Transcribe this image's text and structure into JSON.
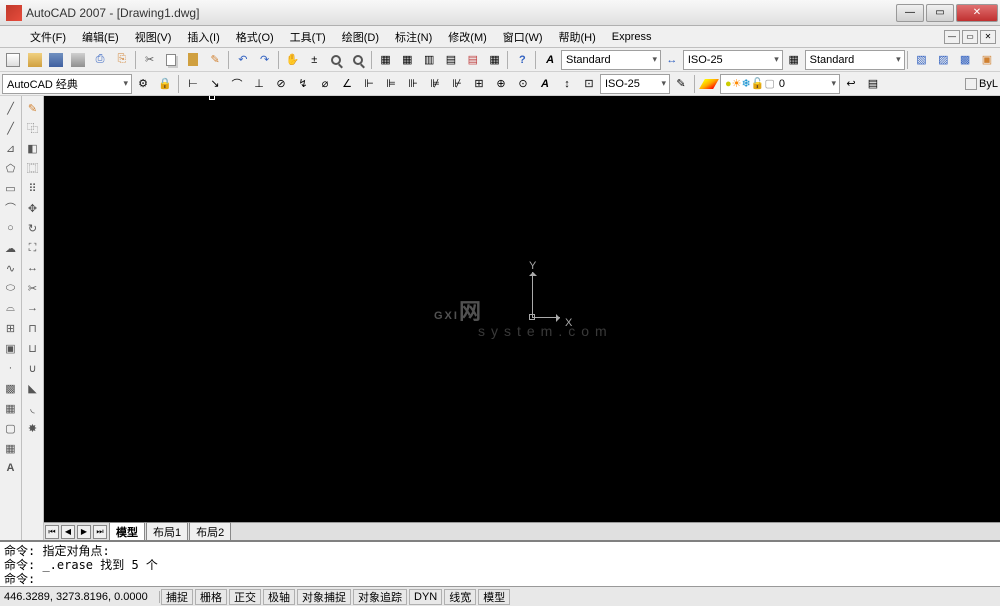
{
  "title": "AutoCAD 2007 - [Drawing1.dwg]",
  "menu": [
    "文件(F)",
    "编辑(E)",
    "视图(V)",
    "插入(I)",
    "格式(O)",
    "工具(T)",
    "绘图(D)",
    "标注(N)",
    "修改(M)",
    "窗口(W)",
    "帮助(H)",
    "Express"
  ],
  "workspace": "AutoCAD 经典",
  "styles": {
    "text_style": "Standard",
    "dim_style_1": "ISO-25",
    "table_style": "Standard",
    "dim_style_2": "ISO-25"
  },
  "layer": {
    "current": "0"
  },
  "bylayer": "ByL",
  "ucs": {
    "x_label": "X",
    "y_label": "Y"
  },
  "watermark": {
    "main": "GXI",
    "suffix": "网",
    "sub": "system.com"
  },
  "layout_tabs": {
    "model": "模型",
    "layout1": "布局1",
    "layout2": "布局2"
  },
  "command_log": "命令: 指定对角点:\n命令: _.erase 找到 5 个\n命令:",
  "status": {
    "coords": "446.3289, 3273.8196, 0.0000",
    "toggles": [
      "捕捉",
      "栅格",
      "正交",
      "极轴",
      "对象捕捉",
      "对象追踪",
      "DYN",
      "线宽",
      "模型"
    ]
  }
}
